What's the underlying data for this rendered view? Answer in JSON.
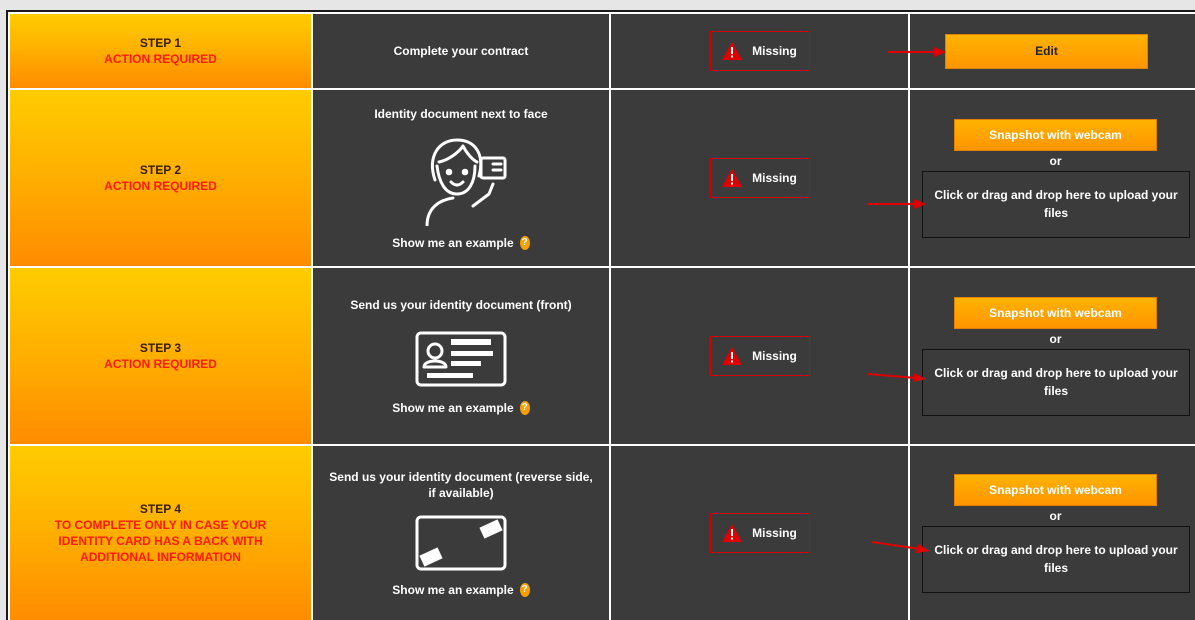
{
  "steps": [
    {
      "title": "STEP 1",
      "status_lines": [
        "ACTION REQUIRED"
      ],
      "description": "Complete your contract",
      "state": "Missing",
      "action": {
        "type": "edit",
        "label": "Edit"
      }
    },
    {
      "title": "STEP 2",
      "status_lines": [
        "ACTION REQUIRED"
      ],
      "description": "Identity document next to face",
      "illustration": "person-holding-id-icon",
      "example_label": "Show me an example",
      "state": "Missing",
      "action": {
        "type": "upload",
        "webcam_label": "Snapshot with webcam",
        "or_label": "or",
        "drop_label": "Click or drag and drop here to upload your files"
      }
    },
    {
      "title": "STEP 3",
      "status_lines": [
        "ACTION REQUIRED"
      ],
      "description": "Send us your identity document (front)",
      "illustration": "id-card-front-icon",
      "example_label": "Show me an example",
      "state": "Missing",
      "action": {
        "type": "upload",
        "webcam_label": "Snapshot with webcam",
        "or_label": "or",
        "drop_label": "Click or drag and drop here to upload your files"
      }
    },
    {
      "title": "STEP 4",
      "status_lines": [
        "TO COMPLETE ONLY IN CASE YOUR",
        "IDENTITY CARD HAS A BACK WITH",
        "ADDITIONAL INFORMATION"
      ],
      "description": "Send us your identity document (reverse side, if available)",
      "illustration": "id-card-back-icon",
      "example_label": "Show me an example",
      "state": "Missing",
      "action": {
        "type": "upload",
        "webcam_label": "Snapshot with webcam",
        "or_label": "or",
        "drop_label": "Click or drag and drop here to upload your files"
      }
    }
  ],
  "colors": {
    "panel_bg": "#3b3b3b",
    "step_gradient_top": "#ffcc00",
    "step_gradient_bottom": "#ff8c00",
    "alert_red": "#ff1a0a",
    "button_orange": "#ff9f00",
    "arrow_red": "#e00000"
  }
}
